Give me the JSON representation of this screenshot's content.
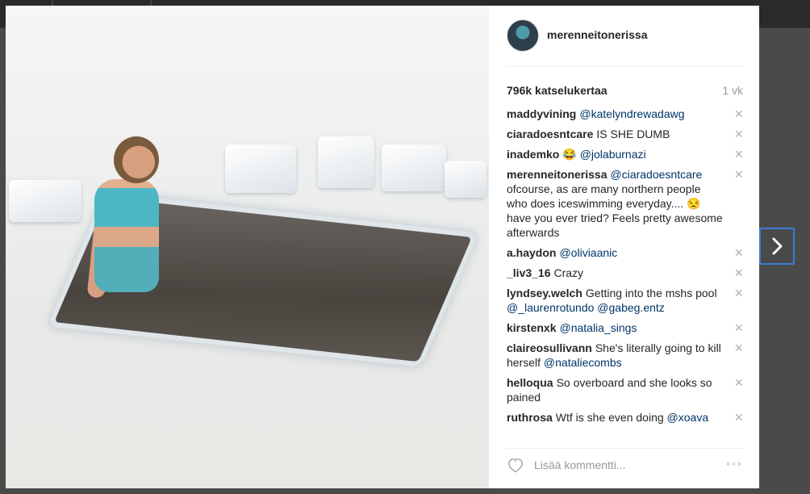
{
  "post": {
    "username": "merenneitonerissa",
    "views": "796k katselukertaa",
    "time_ago": "1 vk"
  },
  "comments": [
    {
      "user": "maddyvining",
      "text": "",
      "mention": "@katelyndrewadawg",
      "suffix": ""
    },
    {
      "user": "ciaradoesntcare",
      "text": "IS SHE DUMB",
      "mention": "",
      "suffix": ""
    },
    {
      "user": "inademko",
      "text": "😂",
      "mention": "@jolaburnazi",
      "suffix": ""
    },
    {
      "user": "merenneitonerissa",
      "text": "",
      "mention": "@ciaradoesntcare",
      "suffix": " ofcourse, as are many northern people who does iceswimming everyday.... 😒have you ever tried? Feels pretty awesome afterwards"
    },
    {
      "user": "a.haydon",
      "text": "",
      "mention": "@oliviaanic",
      "suffix": ""
    },
    {
      "user": "_liv3_16",
      "text": "Crazy",
      "mention": "",
      "suffix": ""
    },
    {
      "user": "lyndsey.welch",
      "text": "Getting into the mshs pool",
      "mention": "@_laurenrotundo @gabeg.entz",
      "suffix": ""
    },
    {
      "user": "kirstenxk",
      "text": "",
      "mention": "@natalia_sings",
      "suffix": ""
    },
    {
      "user": "claireosullivann",
      "text": "She's literally going to kill herself",
      "mention": "@nataliecombs",
      "suffix": ""
    },
    {
      "user": "helloqua",
      "text": "So overboard and she looks so pained",
      "mention": "",
      "suffix": ""
    },
    {
      "user": "ruthrosa",
      "text": "Wtf is she even doing",
      "mention": "@xoava",
      "suffix": ""
    }
  ],
  "footer": {
    "comment_placeholder": "Lisää kommentti...",
    "more_label": "◦◦◦"
  },
  "icons": {
    "close": "×",
    "heart": "heart-outline-icon",
    "next": "chevron-right-icon"
  },
  "colors": {
    "mention": "#003569",
    "next_border": "#3b7bd9"
  }
}
